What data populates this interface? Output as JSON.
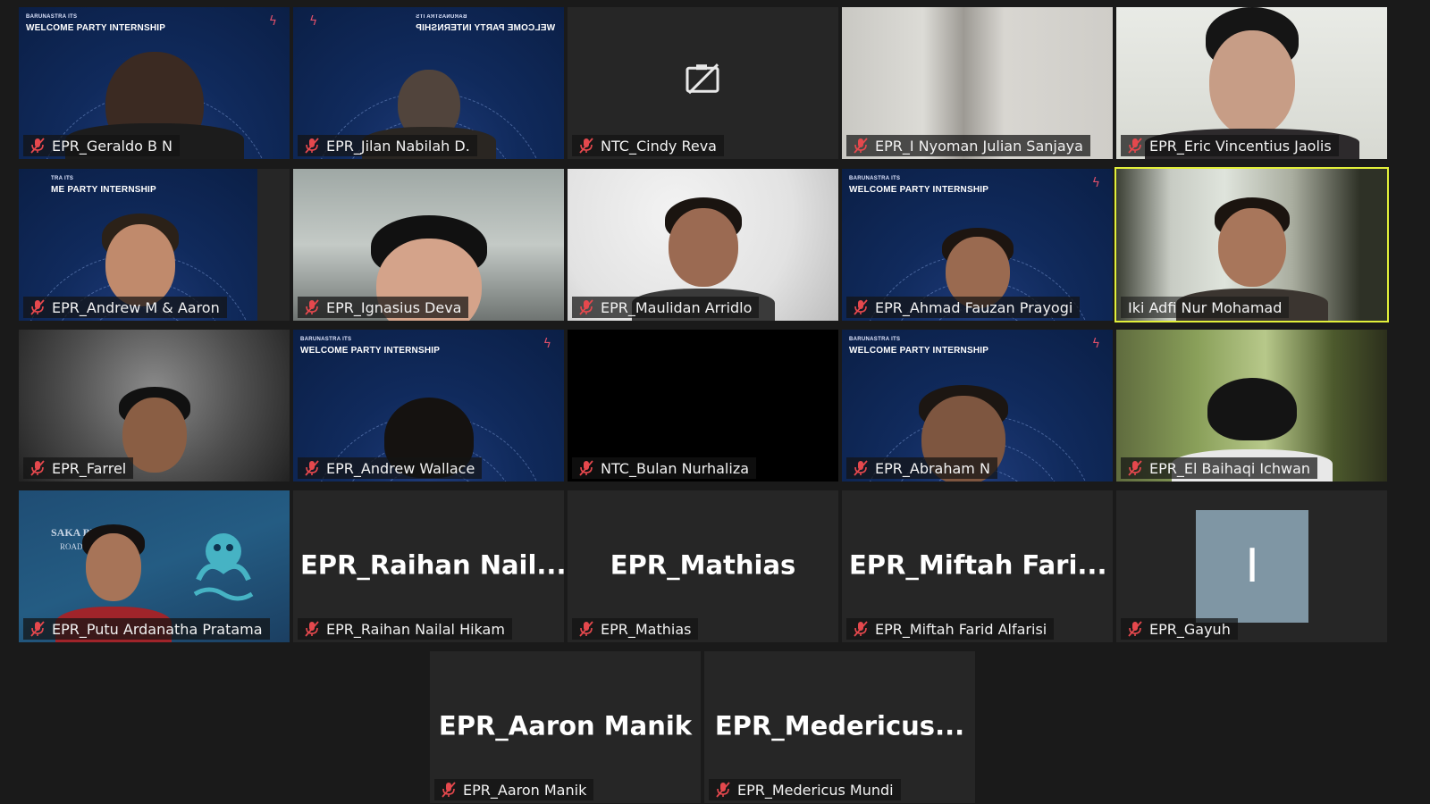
{
  "participants": [
    {
      "name": "EPR_Geraldo B N"
    },
    {
      "name": "EPR_Jilan Nabilah D."
    },
    {
      "name": "NTC_Cindy Reva"
    },
    {
      "name": "EPR_I Nyoman Julian Sanjaya"
    },
    {
      "name": "EPR_Eric Vincentius Jaolis"
    },
    {
      "name": "EPR_Andrew M & Aaron"
    },
    {
      "name": "EPR_Ignasius Deva"
    },
    {
      "name": "EPR_Maulidan Arridlo"
    },
    {
      "name": "EPR_Ahmad Fauzan Prayogi"
    },
    {
      "name": "Iki Adfi Nur Mohamad"
    },
    {
      "name": "EPR_Farrel"
    },
    {
      "name": "EPR_Andrew Wallace"
    },
    {
      "name": "NTC_Bulan Nurhaliza"
    },
    {
      "name": "EPR_Abraham N"
    },
    {
      "name": "EPR_El Baihaqi Ichwan"
    },
    {
      "name": "EPR_Putu Ardanatha Pratama"
    },
    {
      "name": "EPR_Raihan Nailal Hikam",
      "display": "EPR_Raihan  Nail..."
    },
    {
      "name": "EPR_Mathias",
      "display": "EPR_Mathias"
    },
    {
      "name": "EPR_Miftah Farid Alfarisi",
      "display": "EPR_Miftah  Fari..."
    },
    {
      "name": "EPR_Gayuh",
      "initial": "I"
    },
    {
      "name": "EPR_Aaron Manik",
      "display": "EPR_Aaron Manik"
    },
    {
      "name": "EPR_Medericus Mundi",
      "display": "EPR_Medericus..."
    }
  ],
  "banner": {
    "org": "BARUNASTRA ITS",
    "title": "WELCOME PARTY INTERNSHIP",
    "cropped_org": "TRA ITS",
    "cropped_title": "ME PARTY INTERNSHIP"
  },
  "slide": {
    "text": "SAKA BRAH     RA",
    "subtext": "ROAD"
  },
  "colors": {
    "background": "#1a1a1a",
    "tile": "#262626",
    "speaking_border": "#e2f03a",
    "mute_icon": "#e5484d"
  },
  "icons": {
    "mute": "microphone-muted-icon",
    "camera_off": "camera-off-icon"
  }
}
